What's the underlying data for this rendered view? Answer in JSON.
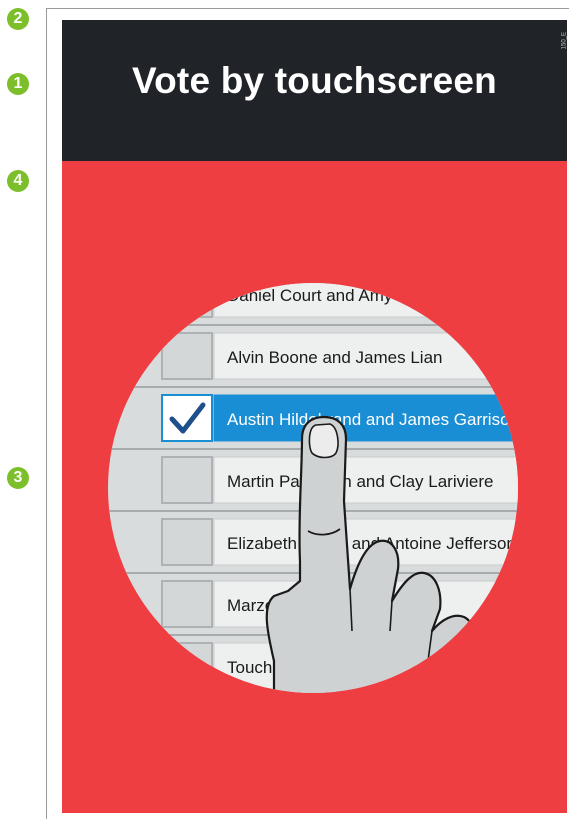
{
  "badges": [
    "2",
    "1",
    "4",
    "3"
  ],
  "header": {
    "title": "Vote by touchscreen",
    "code": "150_E",
    "background": "#202428"
  },
  "panel": {
    "background": "#ef3e42"
  },
  "ballot": {
    "candidates": [
      {
        "label": "Daniel Court and Amy Blake",
        "checked": false
      },
      {
        "label": "Alvin Boone and James Lian",
        "checked": false
      },
      {
        "label": "Austin Hildebrand and James Garrison",
        "checked": true
      },
      {
        "label": "Martin Patterson and Clay Lariviere",
        "checked": false
      },
      {
        "label": "Elizabeth Harris and Antoine Jefferson",
        "checked": false
      },
      {
        "label": "Marzena Pohl",
        "checked": false
      },
      {
        "label": "Touch here",
        "checked": false
      }
    ],
    "selected_color": "#1a8ed4",
    "checkmark_color": "#1d4f8a"
  },
  "icons": [
    "hand-pointer-icon",
    "checkmark-icon"
  ]
}
